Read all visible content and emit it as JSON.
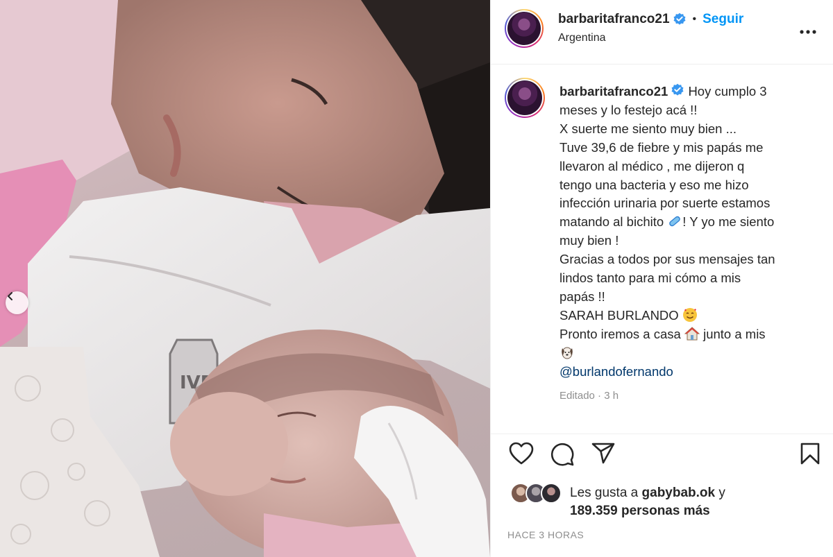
{
  "post": {
    "username": "barbaritafranco21",
    "verified": true,
    "follow_label": "Seguir",
    "separator": "•",
    "location": "Argentina",
    "more_icon": "more-options-icon"
  },
  "caption": {
    "username": "barbaritafranco21",
    "lines": [
      "Hoy cumplo 3",
      "meses y lo festejo acá !!",
      "X suerte me siento muy bien ...",
      "Tuve 39,6 de fiebre y mis papás me",
      "llevaron al médico , me dijeron q",
      "tengo una bacteria y eso me hizo",
      "infección urinaria por suerte estamos",
      "matando al bichito",
      "! Y yo me siento",
      "muy bien !",
      "Gracias a todos por sus mensajes tan",
      "lindos tanto para mi cómo a mis",
      "papás !!",
      "SARAH BURLANDO",
      "Pronto iremos a casa",
      "junto a mis",
      "@burlandofernando"
    ],
    "emojis": [
      "pill-emoji",
      "smiling-face-with-hearts-emoji",
      "house-emoji",
      "dog-emoji"
    ],
    "meta": "Editado · 3 h"
  },
  "actions": {
    "icons": [
      "heart-icon",
      "comment-icon",
      "share-icon",
      "bookmark-icon"
    ]
  },
  "likes": {
    "prefix": "Les gusta a ",
    "user": "gabybab.ok",
    "connector": " y",
    "count": "189.359 personas más"
  },
  "timestamp": "HACE 3 HORAS",
  "colors": {
    "accent": "#0095f6",
    "verified": "#3897f0",
    "mention": "#00376b",
    "muted": "#8e8e8e",
    "border": "#efefef"
  }
}
